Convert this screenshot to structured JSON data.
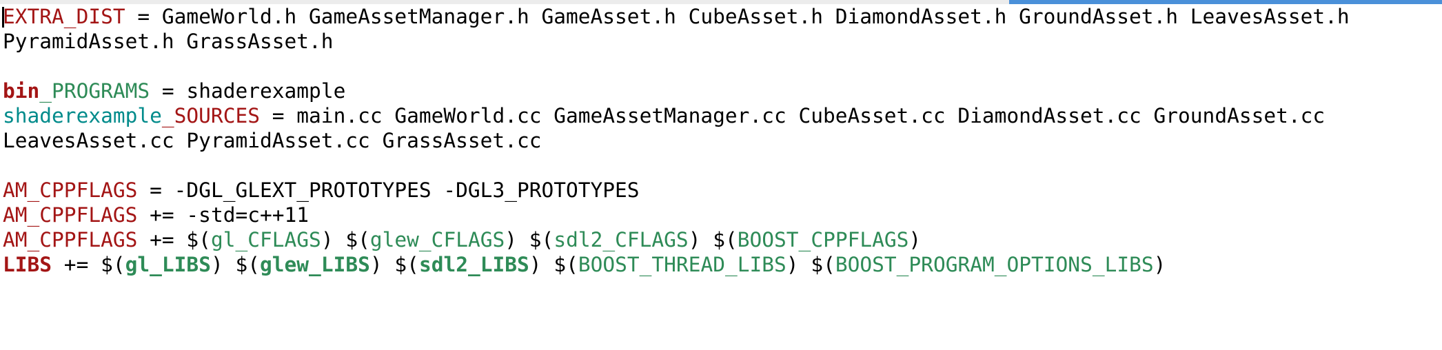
{
  "colors": {
    "keyword": "#a31515",
    "variable": "#2e8b57",
    "identifier": "#008b8b",
    "text": "#000000",
    "scrollbar_thumb": "#4a90d9"
  },
  "scrollbar": {
    "visible_fraction": 0.3
  },
  "code": {
    "line1": {
      "name": "EXTRA_DIST",
      "op": " = ",
      "value": "GameWorld.h GameAssetManager.h GameAsset.h CubeAsset.h DiamondAsset.h GroundAsset.h LeavesAsset.h"
    },
    "line2": {
      "value": "PyramidAsset.h GrassAsset.h"
    },
    "line4": {
      "name_a": "bin",
      "name_b": "_PROGRAMS",
      "op": " = ",
      "value": "shaderexample"
    },
    "line5": {
      "name_a": "shaderexample",
      "name_b": "_SOURCES",
      "op": " = ",
      "value": "main.cc GameWorld.cc GameAssetManager.cc CubeAsset.cc DiamondAsset.cc GroundAsset.cc"
    },
    "line6": {
      "value": "LeavesAsset.cc PyramidAsset.cc GrassAsset.cc"
    },
    "line8": {
      "name": "AM_CPPFLAGS",
      "op": " = ",
      "value": "-DGL_GLEXT_PROTOTYPES -DGL3_PROTOTYPES"
    },
    "line9": {
      "name": "AM_CPPFLAGS",
      "op": " += ",
      "value": "-std=c++11"
    },
    "line10": {
      "name": "AM_CPPFLAGS",
      "op": " += ",
      "open": "$(",
      "close": ")",
      "sep": " ",
      "vars": [
        "gl_CFLAGS",
        "glew_CFLAGS",
        "sdl2_CFLAGS",
        "BOOST_CPPFLAGS"
      ]
    },
    "line11": {
      "name": "LIBS",
      "op": " += ",
      "open": "$(",
      "close": ")",
      "sep": " ",
      "vars": [
        "gl_LIBS",
        "glew_LIBS",
        "sdl2_LIBS",
        "BOOST_THREAD_LIBS",
        "BOOST_PROGRAM_OPTIONS_LIBS"
      ]
    }
  }
}
